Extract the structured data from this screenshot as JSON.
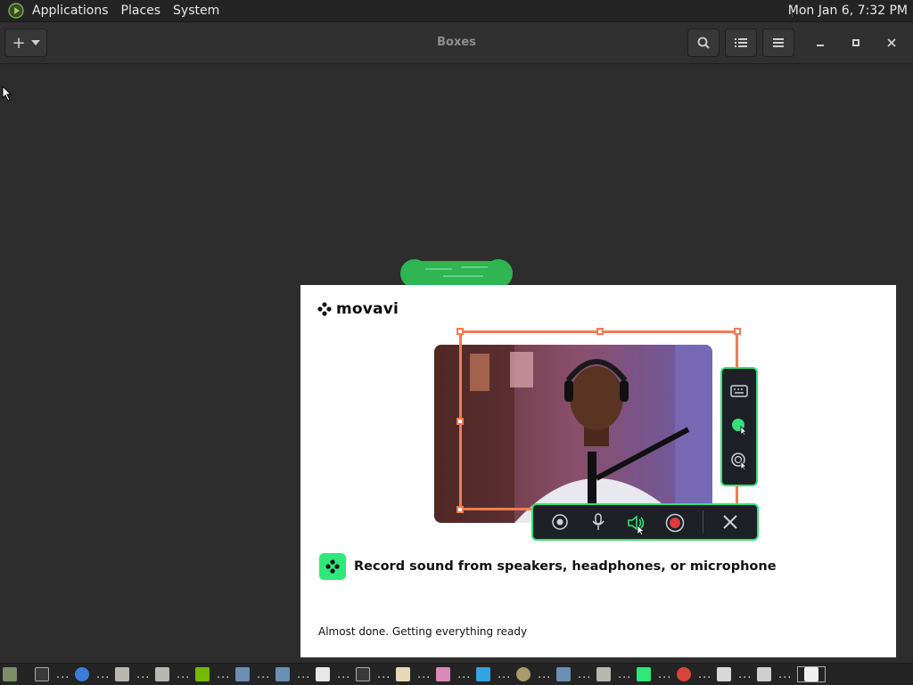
{
  "top_panel": {
    "menus": [
      "Applications",
      "Places",
      "System"
    ],
    "clock": "Mon Jan  6,  7:32 PM"
  },
  "window": {
    "title": "Boxes",
    "new_box_symbol": "+",
    "icons": {
      "new": "plus-icon",
      "search": "search-icon",
      "list": "list-view-icon",
      "menu": "hamburger-menu-icon",
      "minimize": "minimize-icon",
      "maximize": "maximize-icon",
      "close": "close-icon"
    }
  },
  "installer": {
    "brand": "movavi",
    "brand_icon": "movavi-logo-icon",
    "feature_text": "Record sound from speakers, headphones, or microphone",
    "status_text": "Almost done. Getting everything ready",
    "accent_color": "#34e07a",
    "frame_color": "#f47b4f",
    "side_toolbar_icons": [
      "keyboard-icon",
      "cursor-highlight-icon",
      "click-effect-icon"
    ],
    "bottom_toolbar_icons": [
      "webcam-icon",
      "microphone-icon",
      "speaker-icon",
      "record-icon",
      "close-icon"
    ]
  },
  "taskbar": {
    "tasks": [
      {
        "icon": "file-manager-icon",
        "label": "..."
      },
      {
        "icon": "terminal-icon",
        "label": "..."
      },
      {
        "icon": "chromium-icon",
        "label": "..."
      },
      {
        "icon": "folder-icon",
        "label": "..."
      },
      {
        "icon": "folder-icon",
        "label": "..."
      },
      {
        "icon": "nvidia-icon",
        "label": "..."
      },
      {
        "icon": "network-icon",
        "label": "..."
      },
      {
        "icon": "network-icon",
        "label": "..."
      },
      {
        "icon": "archive-7z-icon",
        "label": "..."
      },
      {
        "icon": "terminal-icon",
        "label": "..."
      },
      {
        "icon": "text-editor-icon",
        "label": "..."
      },
      {
        "icon": "image-viewer-icon",
        "label": "..."
      },
      {
        "icon": "play-store-icon",
        "label": "..."
      },
      {
        "icon": "disk-icon",
        "label": "..."
      },
      {
        "icon": "network-icon",
        "label": "..."
      },
      {
        "icon": "folder-icon",
        "label": "..."
      },
      {
        "icon": "movavi-icon",
        "label": "..."
      },
      {
        "icon": "chrome-icon",
        "label": "..."
      },
      {
        "icon": "package-icon",
        "label": "..."
      },
      {
        "icon": "screenshot-icon",
        "label": "..."
      },
      {
        "icon": "boxes-icon",
        "label": ""
      }
    ]
  }
}
